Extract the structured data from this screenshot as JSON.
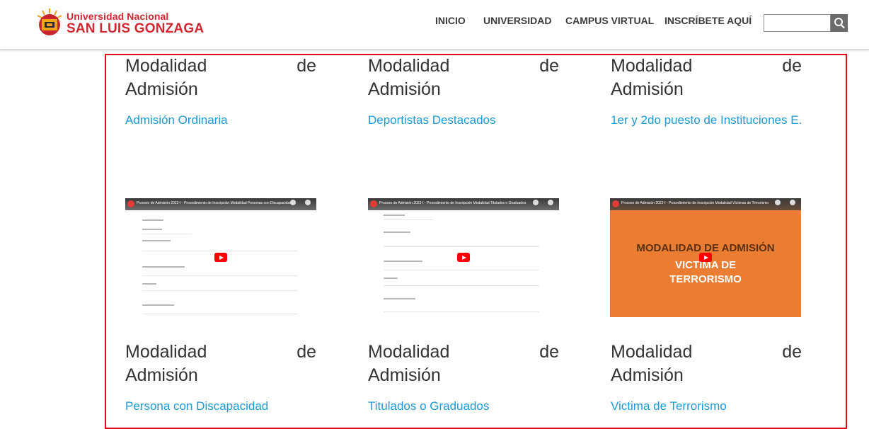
{
  "header": {
    "logo": {
      "line1": "Universidad Nacional",
      "line2": "SAN LUIS GONZAGA"
    },
    "nav": [
      {
        "label": "INICIO"
      },
      {
        "label": "UNIVERSIDAD"
      },
      {
        "label": "CAMPUS VIRTUAL"
      },
      {
        "label": "INSCRÍBETE AQUÍ"
      }
    ],
    "search": {
      "value": "",
      "icon": "search-icon"
    }
  },
  "cards": [
    {
      "heading_a": "Modalidad",
      "heading_b": "de",
      "heading_c": "Admisión",
      "link": "Admisión Ordinaria"
    },
    {
      "heading_a": "Modalidad",
      "heading_b": "de",
      "heading_c": "Admisión",
      "link": "Deportistas Destacados"
    },
    {
      "heading_a": "Modalidad",
      "heading_b": "de",
      "heading_c": "Admisión",
      "link": "1er y 2do puesto de Instituciones E."
    },
    {
      "heading_a": "Modalidad",
      "heading_b": "de",
      "heading_c": "Admisión",
      "link": "Persona con Discapacidad",
      "video": {
        "title": "Proceso de Admisión 2022-I - Procedimiento de Inscripción Modalidad Personas con Discapacidad"
      }
    },
    {
      "heading_a": "Modalidad",
      "heading_b": "de",
      "heading_c": "Admisión",
      "link": "Titulados o Graduados",
      "video": {
        "title": "Proceso de Admisión 2022-I - Procedimiento de Inscripción Modalidad Titulados o Graduados"
      }
    },
    {
      "heading_a": "Modalidad",
      "heading_b": "de",
      "heading_c": "Admisión",
      "link": "Victima de Terrorismo",
      "video": {
        "title": "Proceso de Admisión 2022-I - Procedimiento de Inscripción Modalidad Víctimas de Terrorismo",
        "overlay_1": "MODALIDAD DE ADMISIÓN",
        "overlay_2": "VICTIMA DE",
        "overlay_3": "TERRORISMO"
      }
    }
  ],
  "colors": {
    "brand_red": "#d22730",
    "link_blue": "#1a9ad6",
    "frame_red": "#e00b1b",
    "thumb_orange": "#ea7d32"
  }
}
